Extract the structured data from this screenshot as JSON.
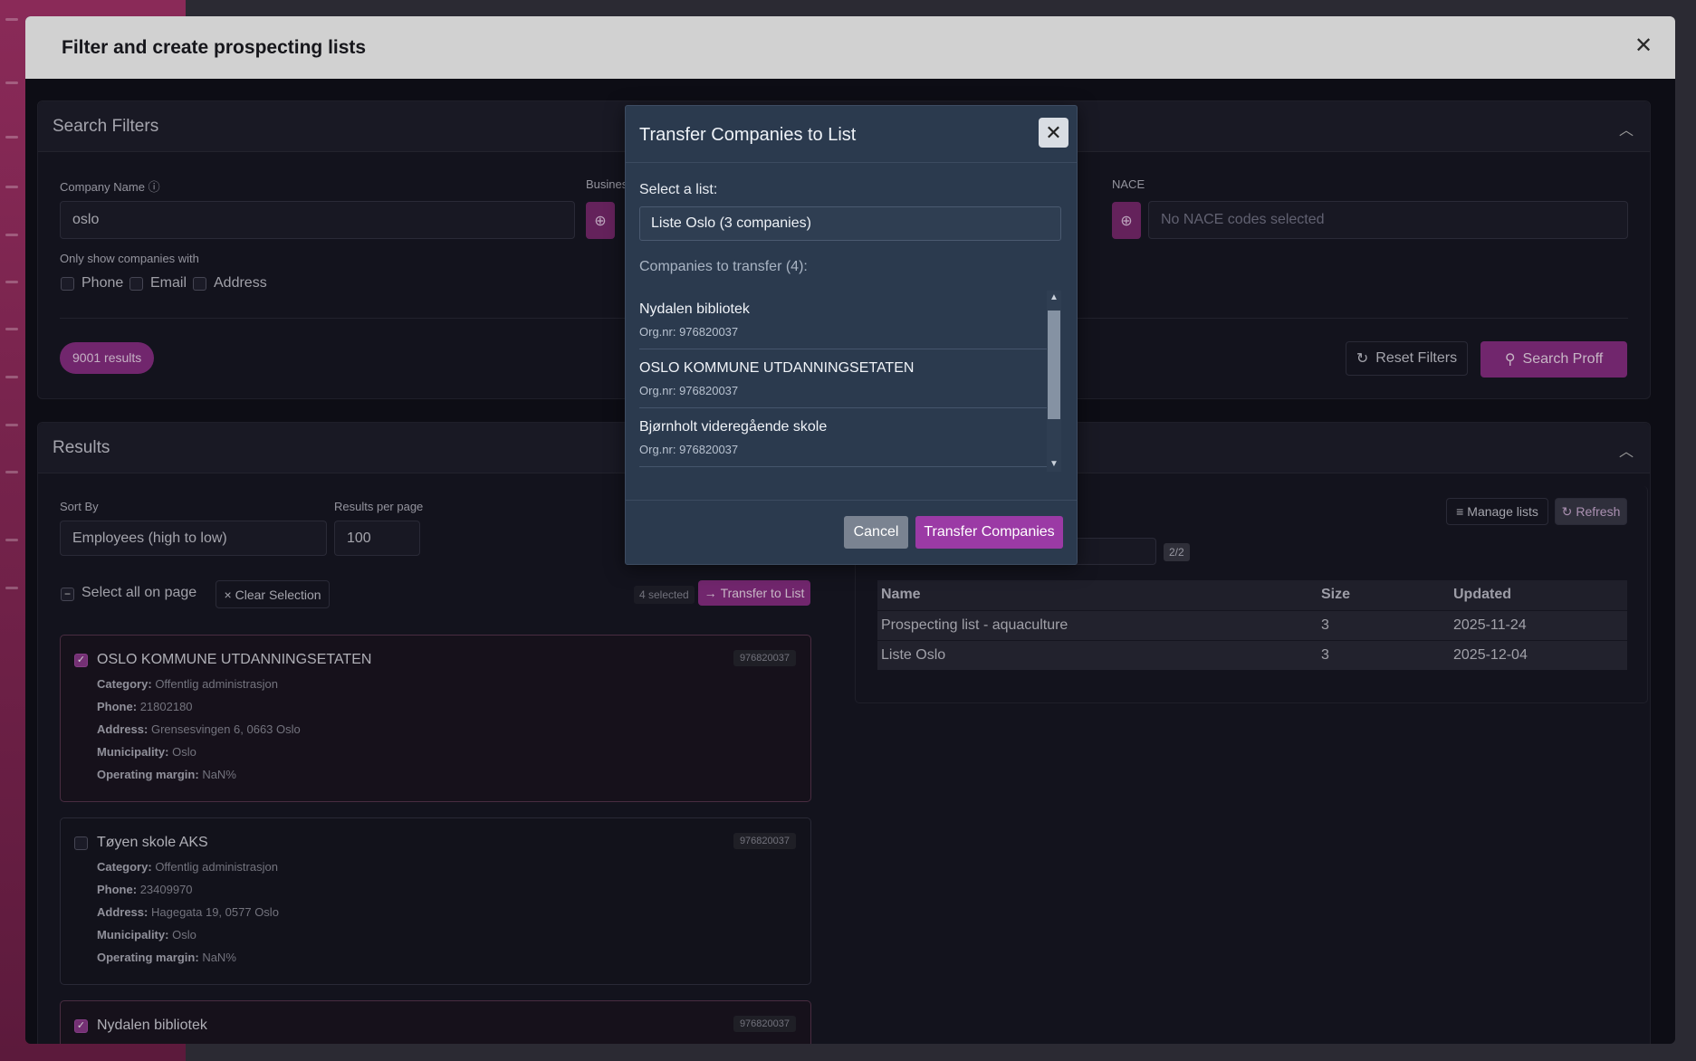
{
  "main": {
    "title": "Filter and create prospecting lists",
    "close_icon": "close-icon"
  },
  "search_filters": {
    "title": "Search Filters",
    "company_name_label": "Company Name",
    "company_name_value": "oslo",
    "business_label": "Busines",
    "nace_label": "NACE",
    "nace_placeholder": "No NACE codes selected",
    "only_show_label": "Only show companies with",
    "checkbox_phone": "Phone",
    "checkbox_email": "Email",
    "checkbox_address": "Address",
    "results_count": "9001 results",
    "reset_label": "Reset Filters",
    "search_label": "Search Proff"
  },
  "results": {
    "title": "Results",
    "sort_by_label": "Sort By",
    "sort_by_value": "Employees (high to low)",
    "per_page_label": "Results per page",
    "per_page_value": "100",
    "select_all": "Select all on page",
    "clear_selection": "Clear Selection",
    "selected_count": "4 selected",
    "transfer_to_list": "Transfer to List",
    "companies": [
      {
        "name": "OSLO KOMMUNE UTDANNINGSETATEN",
        "org": "976820037",
        "selected": true,
        "category_label": "Category:",
        "category": "Offentlig administrasjon",
        "phone_label": "Phone:",
        "phone": "21802180",
        "address_label": "Address:",
        "address": "Grensesvingen 6, 0663 Oslo",
        "municipality_label": "Municipality:",
        "municipality": "Oslo",
        "margin_label": "Operating margin:",
        "margin": "NaN%"
      },
      {
        "name": "Tøyen skole AKS",
        "org": "976820037",
        "selected": false,
        "category_label": "Category:",
        "category": "Offentlig administrasjon",
        "phone_label": "Phone:",
        "phone": "23409970",
        "address_label": "Address:",
        "address": "Hagegata 19, 0577 Oslo",
        "municipality_label": "Municipality:",
        "municipality": "Oslo",
        "margin_label": "Operating margin:",
        "margin": "NaN%"
      },
      {
        "name": "Nydalen bibliotek",
        "org": "976820037",
        "selected": true
      }
    ]
  },
  "lists_panel": {
    "manage_lists": "Manage lists",
    "refresh": "Refresh",
    "page_indicator": "2/2",
    "headers": [
      "Name",
      "Size",
      "Updated"
    ],
    "rows": [
      [
        "Prospecting list - aquaculture",
        "3",
        "2025-11-24"
      ],
      [
        "Liste Oslo",
        "3",
        "2025-12-04"
      ]
    ]
  },
  "dialog": {
    "title": "Transfer Companies to List",
    "select_label": "Select a list:",
    "select_value": "Liste Oslo (3 companies)",
    "companies_label": "Companies to transfer (4):",
    "items": [
      {
        "name": "Nydalen bibliotek",
        "org": "Org.nr: 976820037"
      },
      {
        "name": "OSLO KOMMUNE UTDANNINGSETATEN",
        "org": "Org.nr: 976820037"
      },
      {
        "name": "Bjørnholt videregående skole",
        "org": "Org.nr: 976820037"
      }
    ],
    "cancel": "Cancel",
    "transfer": "Transfer Companies"
  }
}
